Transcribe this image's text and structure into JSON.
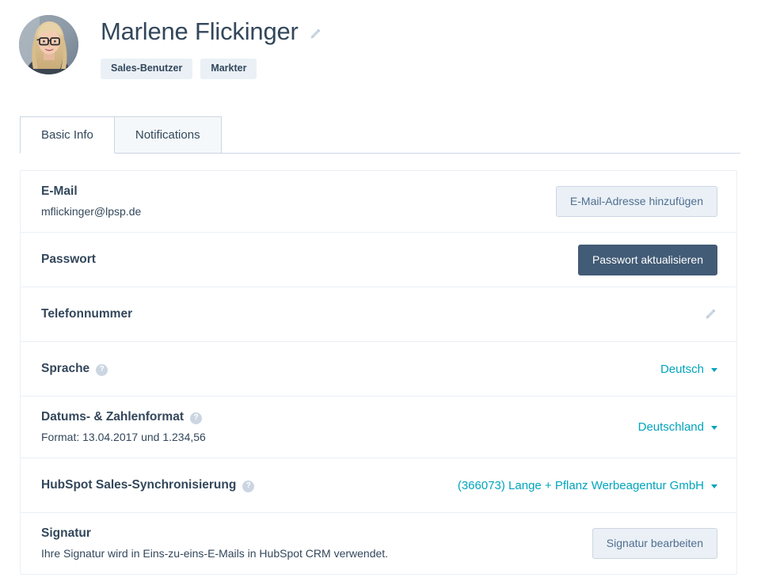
{
  "profile": {
    "name": "Marlene Flickinger",
    "edit_name_icon": "pencil-icon",
    "avatar_alt": "Marlene Flickinger profile photo",
    "badges": [
      "Sales-Benutzer",
      "Markter"
    ]
  },
  "tabs": [
    {
      "label": "Basic Info",
      "active": true
    },
    {
      "label": "Notifications",
      "active": false
    }
  ],
  "rows": {
    "email": {
      "title": "E-Mail",
      "value": "mflickinger@lpsp.de",
      "button": "E-Mail-Adresse hinzufügen"
    },
    "password": {
      "title": "Passwort",
      "button": "Passwort aktualisieren"
    },
    "phone": {
      "title": "Telefonnummer",
      "edit_icon": "pencil-icon"
    },
    "language": {
      "title": "Sprache",
      "help_icon": "help-circle-icon",
      "selected": "Deutsch"
    },
    "date_number_format": {
      "title": "Datums- & Zahlenformat",
      "help_icon": "help-circle-icon",
      "subtitle": "Format: 13.04.2017 und 1.234,56",
      "selected": "Deutschland"
    },
    "hubspot_sync": {
      "title": "HubSpot Sales-Synchronisierung",
      "help_icon": "help-circle-icon",
      "selected": "(366073) Lange + Pflanz Werbeagentur GmbH"
    },
    "signature": {
      "title": "Signatur",
      "subtitle": "Ihre Signatur wird in Eins-zu-eins-E-Mails in HubSpot CRM verwendet.",
      "button": "Signatur bearbeiten"
    }
  },
  "colors": {
    "text_primary": "#33475b",
    "link_teal": "#00a4bd",
    "button_primary_bg": "#425b76",
    "button_secondary_bg": "#eaf0f6",
    "border": "#cbd6e2",
    "card_border": "#eaf0f6"
  }
}
